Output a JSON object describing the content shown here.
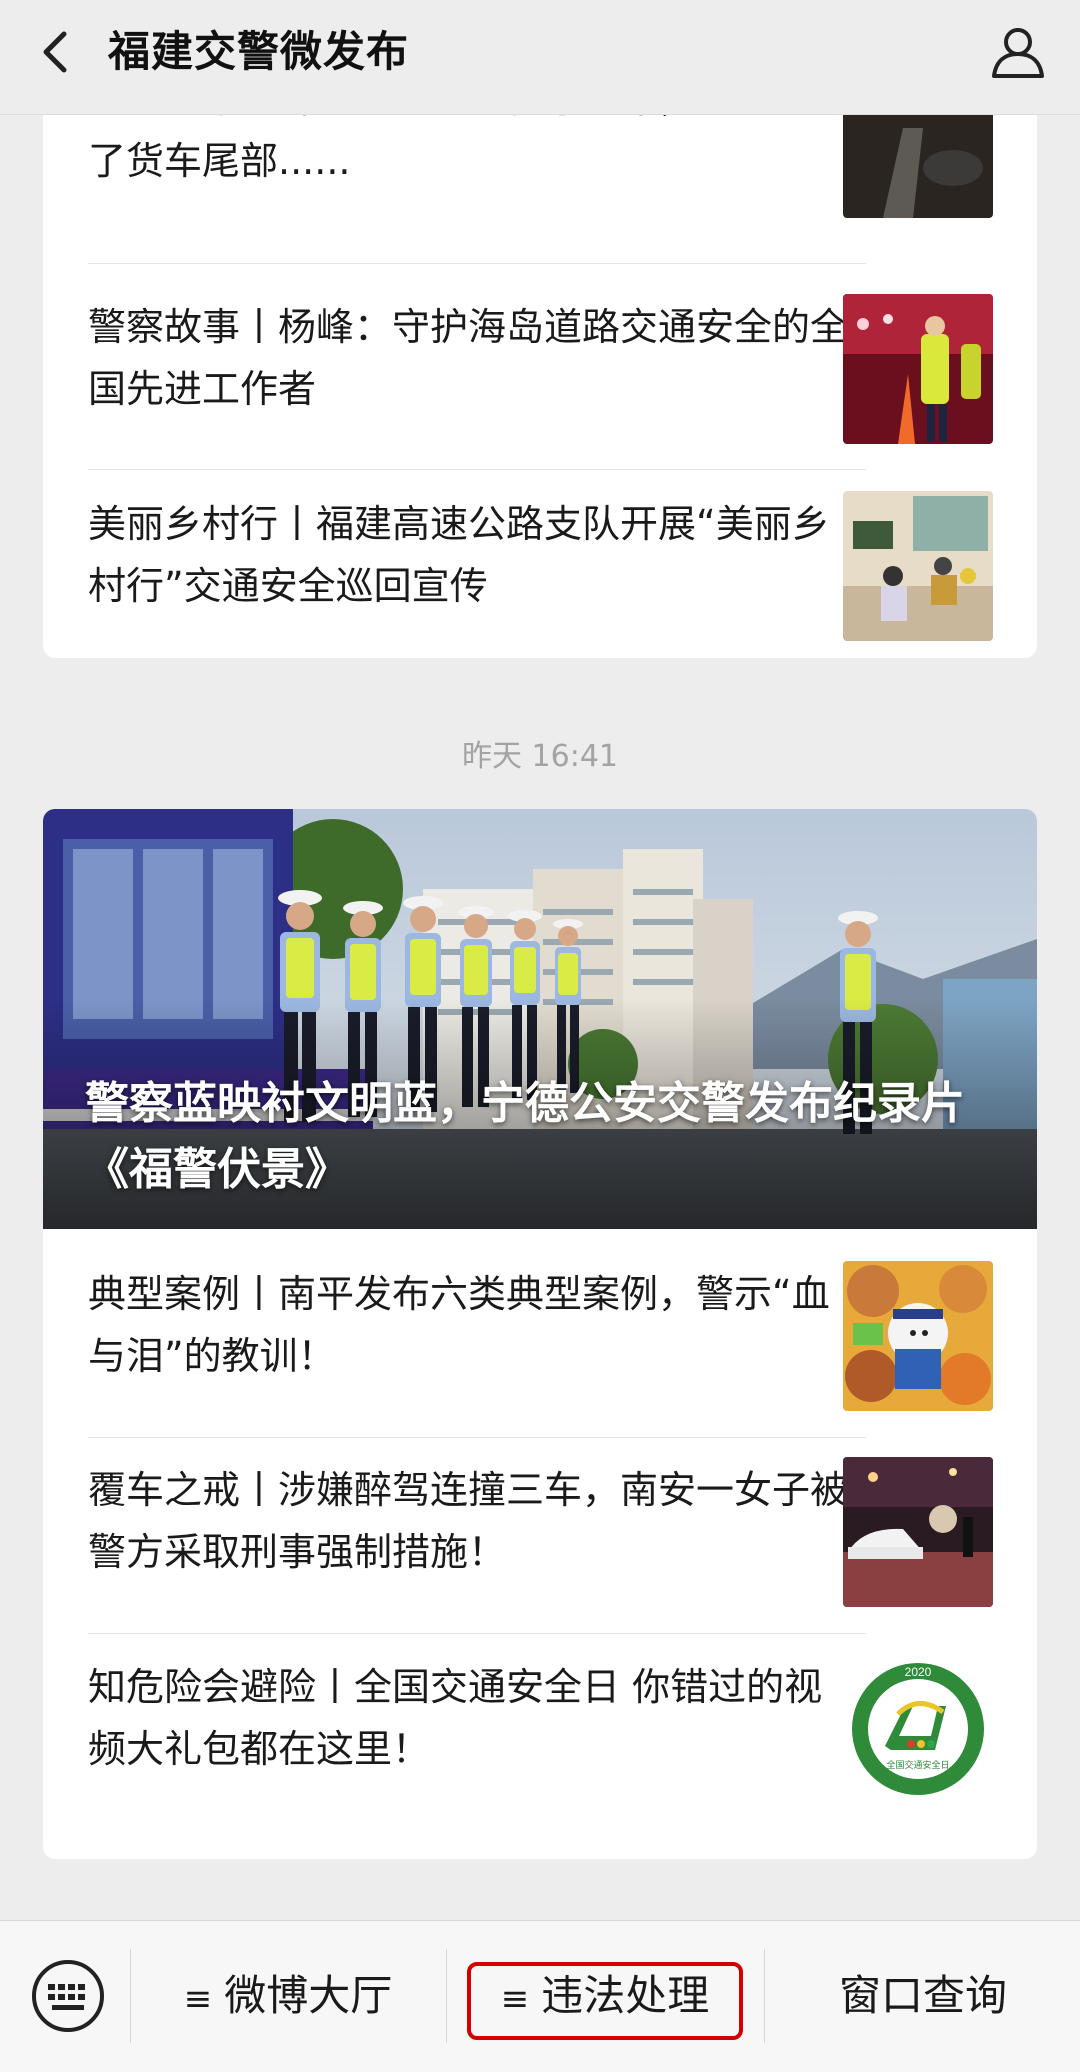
{
  "header": {
    "title": "福建交警微发布"
  },
  "group1": {
    "items": [
      {
        "title": "一盔一带丨醉！这个女子骑摩托车，一头撞上了货车尾部......"
      },
      {
        "title": "警察故事丨杨峰：守护海岛道路交通安全的全国先进工作者"
      },
      {
        "title": "美丽乡村行丨福建高速公路支队开展“美丽乡村行”交通安全巡回宣传"
      }
    ]
  },
  "timestamp": "昨天 16:41",
  "group2": {
    "hero_title": "警察蓝映衬文明蓝，宁德公安交警发布纪录片《福警伏景》",
    "items": [
      {
        "title": "典型案例丨南平发布六类典型案例，警示“血与泪”的教训！"
      },
      {
        "title": "覆车之戒丨涉嫌醉驾连撞三车，南安一女子被警方采取刑事强制措施！"
      },
      {
        "title": "知危险会避险丨全国交通安全日 你错过的视频大礼包都在这里！"
      }
    ],
    "badge_year": "2020",
    "badge_text": "全国交通安全日"
  },
  "bottom_menu": {
    "item1": "微博大厅",
    "item2": "违法处理",
    "item3": "窗口查询",
    "hamburger": "≡"
  },
  "colors": {
    "highlight": "#d40000",
    "background": "#ededed"
  },
  "icons": [
    "back-arrow-icon",
    "profile-icon",
    "keyboard-icon",
    "menu-icon"
  ]
}
